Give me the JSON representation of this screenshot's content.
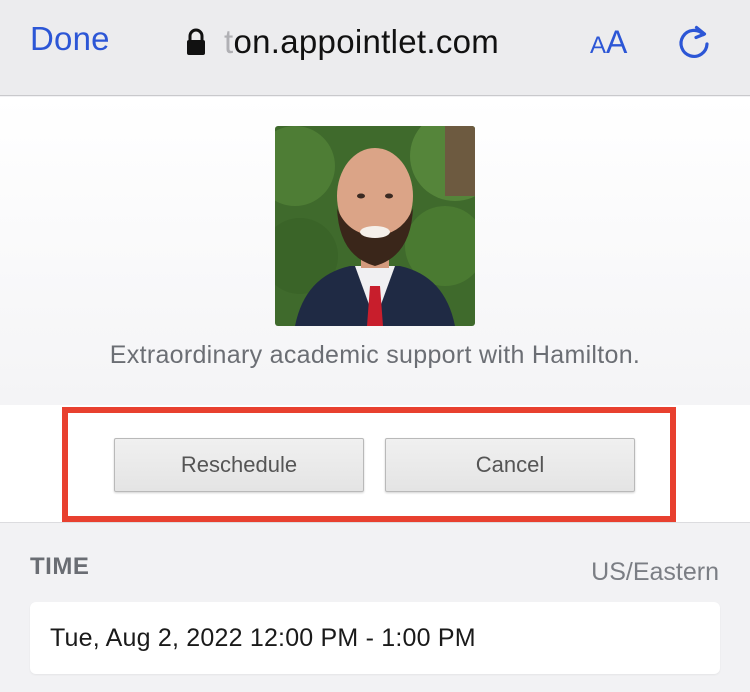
{
  "browser": {
    "done_label": "Done",
    "url_prefix": "t",
    "url_main": "on.appointlet.com",
    "text_size_small": "A",
    "text_size_large": "A"
  },
  "header": {
    "title": "Extraordinary academic support with Hamilton."
  },
  "actions": {
    "reschedule_label": "Reschedule",
    "cancel_label": "Cancel"
  },
  "time": {
    "label": "TIME",
    "timezone": "US/Eastern",
    "value": "Tue, Aug 2, 2022 12:00 PM - 1:00 PM"
  },
  "colors": {
    "accent": "#2c56d6",
    "highlight": "#e8402f"
  }
}
